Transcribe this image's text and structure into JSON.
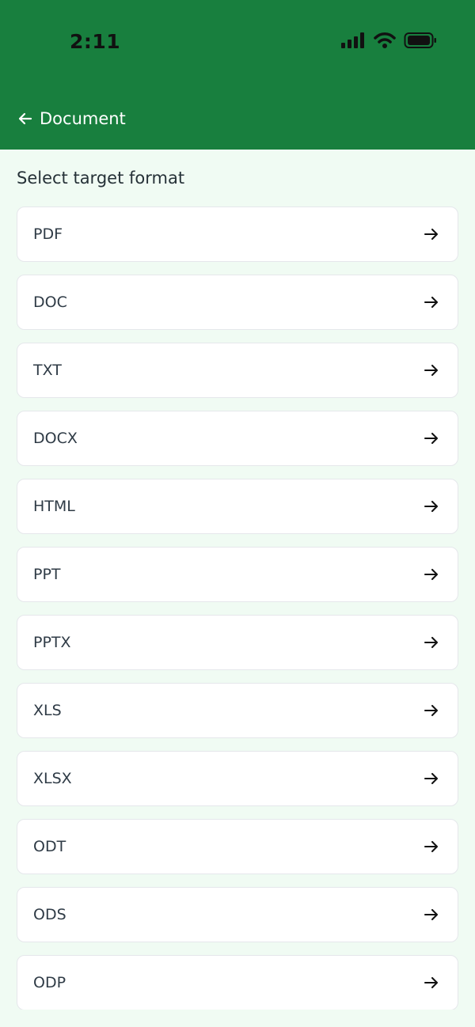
{
  "status_bar": {
    "time": "2:11"
  },
  "header": {
    "title": "Document",
    "background_color": "#187f3e"
  },
  "section": {
    "title": "Select target format"
  },
  "formats": [
    {
      "label": "PDF"
    },
    {
      "label": "DOC"
    },
    {
      "label": "TXT"
    },
    {
      "label": "DOCX"
    },
    {
      "label": "HTML"
    },
    {
      "label": "PPT"
    },
    {
      "label": "PPTX"
    },
    {
      "label": "XLS"
    },
    {
      "label": "XLSX"
    },
    {
      "label": "ODT"
    },
    {
      "label": "ODS"
    },
    {
      "label": "ODP"
    }
  ],
  "icons": {
    "back": "arrow-left-icon",
    "item_action": "arrow-right-icon",
    "signal": "cellular-signal-icon",
    "wifi": "wifi-icon",
    "battery": "battery-icon"
  }
}
